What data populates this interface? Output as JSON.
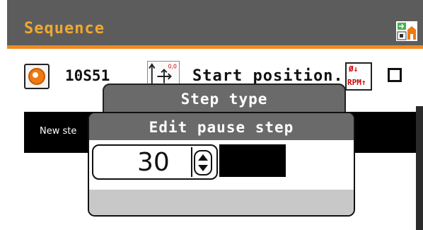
{
  "header": {
    "title": "Sequence",
    "icon": "switch-program-icon"
  },
  "program_row": {
    "program_id": "10S51",
    "program_icon": "disc-tool-icon",
    "position_icon": "start-position-icon",
    "start_position_label": "Start position...",
    "rpm_icon": {
      "top": "Ø↓",
      "bottom": "RPM↑"
    },
    "checkbox_checked": false
  },
  "content": {
    "new_step_text": "New ste"
  },
  "step_type_dialog": {
    "title": "Step type"
  },
  "pause_dialog": {
    "title": "Edit pause step",
    "value": "30"
  },
  "colors": {
    "accent": "#f08a1e",
    "title_text": "#f0a830",
    "header_bg": "#5c5c5c"
  }
}
